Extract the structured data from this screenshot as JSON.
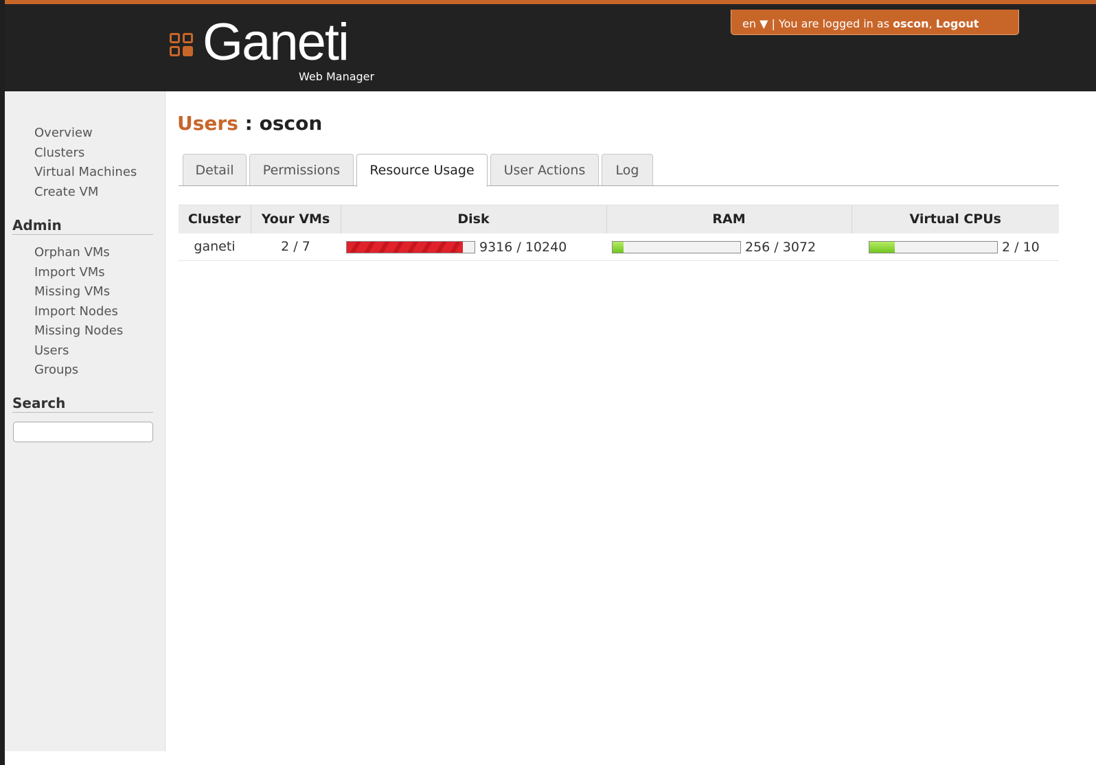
{
  "header": {
    "logo_text": "Ganeti",
    "logo_subtitle": "Web Manager",
    "language": "en",
    "language_arrow": "▼",
    "separator": "|",
    "logged_in_prefix": "You are logged in as",
    "username": "oscon",
    "logout_label": "Logout",
    "brand_color": "#c8662a"
  },
  "sidebar": {
    "main_items": [
      "Overview",
      "Clusters",
      "Virtual Machines",
      "Create VM"
    ],
    "admin_heading": "Admin",
    "admin_items": [
      "Orphan VMs",
      "Import VMs",
      "Missing VMs",
      "Import Nodes",
      "Missing Nodes",
      "Users",
      "Groups"
    ],
    "search_heading": "Search",
    "search_value": ""
  },
  "page": {
    "crumb": "Users",
    "separator": " : ",
    "user": "oscon"
  },
  "tabs": [
    {
      "label": "Detail",
      "active": false
    },
    {
      "label": "Permissions",
      "active": false
    },
    {
      "label": "Resource Usage",
      "active": true
    },
    {
      "label": "User Actions",
      "active": false
    },
    {
      "label": "Log",
      "active": false
    }
  ],
  "table": {
    "headers": [
      "Cluster",
      "Your VMs",
      "Disk",
      "RAM",
      "Virtual CPUs"
    ],
    "rows": [
      {
        "cluster": "ganeti",
        "vms": "2 / 7",
        "disk": {
          "used": 9316,
          "total": 10240,
          "label": "9316 / 10240",
          "color": "red"
        },
        "ram": {
          "used": 256,
          "total": 3072,
          "label": "256 / 3072",
          "color": "green"
        },
        "cpus": {
          "used": 2,
          "total": 10,
          "label": "2 / 10",
          "color": "green"
        }
      }
    ]
  }
}
